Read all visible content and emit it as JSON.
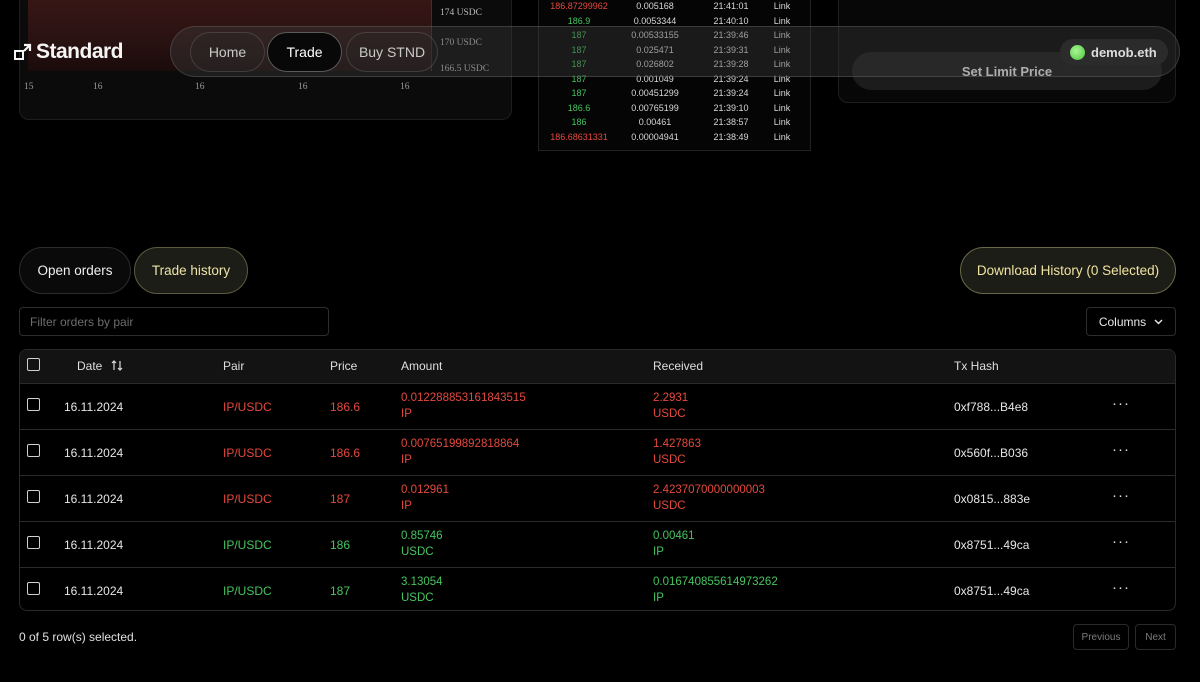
{
  "brand": {
    "name": "Standard"
  },
  "nav": {
    "home": "Home",
    "trade": "Trade",
    "buy": "Buy STND",
    "wallet": "demob.eth"
  },
  "chart": {
    "y_ticks": [
      "174 USDC",
      "170 USDC",
      "166.5 USDC"
    ],
    "x_ticks": [
      "15",
      "16",
      "16",
      "16",
      "16"
    ]
  },
  "orderbook": [
    {
      "price": "186.87299962",
      "side": "red",
      "amount": "0.005168",
      "time": "21:41:01",
      "link": "Link"
    },
    {
      "price": "186.9",
      "side": "green",
      "amount": "0.0053344",
      "time": "21:40:10",
      "link": "Link"
    },
    {
      "price": "187",
      "side": "green",
      "amount": "0.00533155",
      "time": "21:39:46",
      "link": "Link"
    },
    {
      "price": "187",
      "side": "green",
      "amount": "0.025471",
      "time": "21:39:31",
      "link": "Link"
    },
    {
      "price": "187",
      "side": "green",
      "amount": "0.026802",
      "time": "21:39:28",
      "link": "Link"
    },
    {
      "price": "187",
      "side": "green",
      "amount": "0.001049",
      "time": "21:39:24",
      "link": "Link"
    },
    {
      "price": "187",
      "side": "green",
      "amount": "0.00451299",
      "time": "21:39:24",
      "link": "Link"
    },
    {
      "price": "186.6",
      "side": "green",
      "amount": "0.00765199",
      "time": "21:39:10",
      "link": "Link"
    },
    {
      "price": "186",
      "side": "green",
      "amount": "0.00461",
      "time": "21:38:57",
      "link": "Link"
    },
    {
      "price": "186.68631331",
      "side": "red",
      "amount": "0.00004941",
      "time": "21:38:49",
      "link": "Link"
    }
  ],
  "limit": {
    "button": "Set Limit Price"
  },
  "tabs": {
    "open": "Open orders",
    "history": "Trade history"
  },
  "download": "Download History (0 Selected)",
  "filter": {
    "placeholder": "Filter orders by pair",
    "value": ""
  },
  "columns_button": "Columns",
  "table": {
    "headers": {
      "date": "Date",
      "pair": "Pair",
      "price": "Price",
      "amount": "Amount",
      "received": "Received",
      "tx": "Tx Hash"
    },
    "rows": [
      {
        "date": "16.11.2024",
        "pair": "IP/USDC",
        "price": "186.6",
        "amount": "0.012288853161843515",
        "amount_unit": "IP",
        "received": "2.2931",
        "received_unit": "USDC",
        "tx": "0xf788...B4e8",
        "side": "red"
      },
      {
        "date": "16.11.2024",
        "pair": "IP/USDC",
        "price": "186.6",
        "amount": "0.00765199892818864",
        "amount_unit": "IP",
        "received": "1.427863",
        "received_unit": "USDC",
        "tx": "0x560f...B036",
        "side": "red"
      },
      {
        "date": "16.11.2024",
        "pair": "IP/USDC",
        "price": "187",
        "amount": "0.012961",
        "amount_unit": "IP",
        "received": "2.4237070000000003",
        "received_unit": "USDC",
        "tx": "0x0815...883e",
        "side": "red"
      },
      {
        "date": "16.11.2024",
        "pair": "IP/USDC",
        "price": "186",
        "amount": "0.85746",
        "amount_unit": "USDC",
        "received": "0.00461",
        "received_unit": "IP",
        "tx": "0x8751...49ca",
        "side": "green"
      },
      {
        "date": "16.11.2024",
        "pair": "IP/USDC",
        "price": "187",
        "amount": "3.13054",
        "amount_unit": "USDC",
        "received": "0.016740855614973262",
        "received_unit": "IP",
        "tx": "0x8751...49ca",
        "side": "green"
      }
    ]
  },
  "footer": {
    "selected": "0 of 5 row(s) selected.",
    "previous": "Previous",
    "next": "Next"
  },
  "colors": {
    "sell": "#e5493d",
    "buy": "#46c45f",
    "accent": "#ece3a9"
  }
}
